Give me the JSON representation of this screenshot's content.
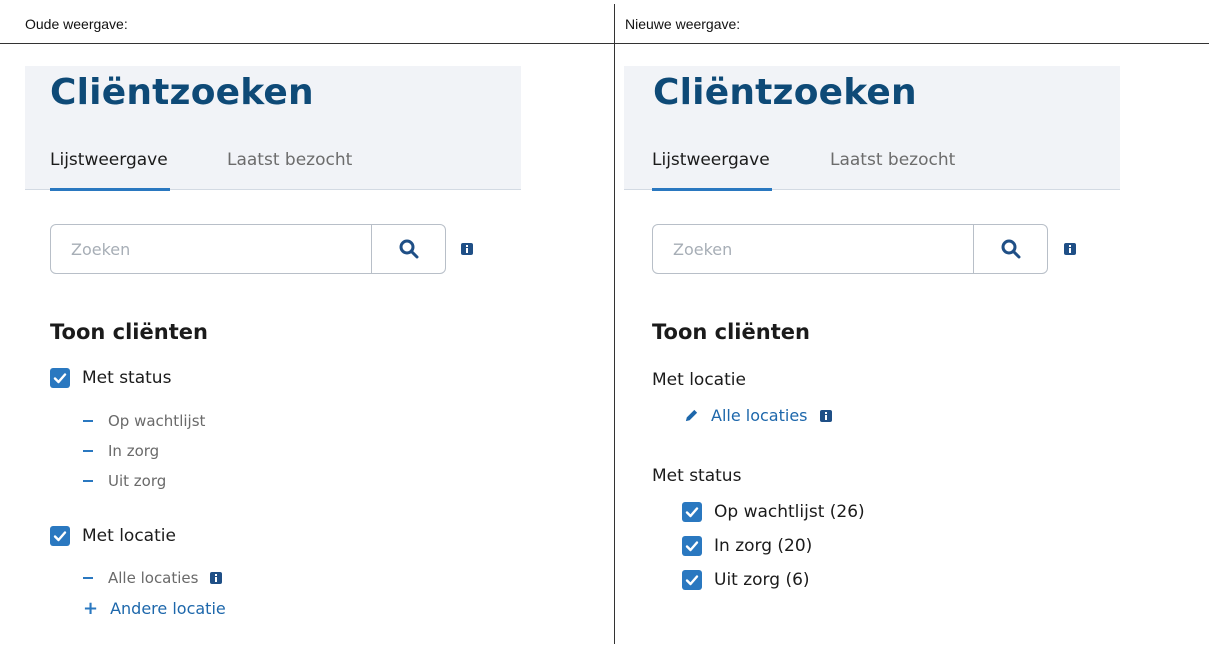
{
  "captions": {
    "old": "Oude weergave:",
    "new": "Nieuwe weergave:"
  },
  "old": {
    "title": "Cliëntzoeken",
    "tabs": [
      {
        "label": "Lijstweergave",
        "active": true
      },
      {
        "label": "Laatst bezocht",
        "active": false
      }
    ],
    "search": {
      "placeholder": "Zoeken"
    },
    "section_title": "Toon cliënten",
    "status_filter": {
      "label": "Met status",
      "checked": true,
      "items": [
        "Op wachtlijst",
        "In zorg",
        "Uit zorg"
      ]
    },
    "location_filter": {
      "label": "Met locatie",
      "checked": true,
      "items": [
        "Alle locaties"
      ],
      "add_label": "Andere locatie"
    }
  },
  "new": {
    "title": "Cliëntzoeken",
    "tabs": [
      {
        "label": "Lijstweergave",
        "active": true
      },
      {
        "label": "Laatst bezocht",
        "active": false
      }
    ],
    "search": {
      "placeholder": "Zoeken"
    },
    "section_title": "Toon cliënten",
    "location_group": {
      "label": "Met locatie",
      "link": "Alle locaties"
    },
    "status_group": {
      "label": "Met status",
      "items": [
        {
          "label": "Op wachtlijst (26)",
          "checked": true
        },
        {
          "label": "In zorg (20)",
          "checked": true
        },
        {
          "label": "Uit zorg (6)",
          "checked": true
        }
      ]
    }
  },
  "colors": {
    "title": "#0e4a77",
    "accent": "#2a78c0",
    "header_bg": "#f1f3f7",
    "link": "#1d67ab"
  },
  "icons": {
    "search": "magnifier-icon",
    "info": "info-icon",
    "check": "checkmark-icon",
    "edit": "pencil-icon"
  }
}
